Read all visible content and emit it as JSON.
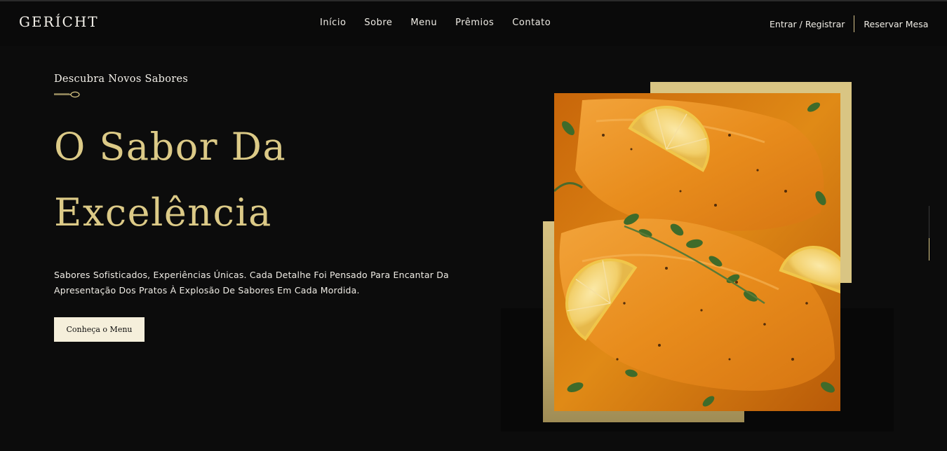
{
  "brand": {
    "logo": "GERÍCHT"
  },
  "nav": {
    "links": [
      "Início",
      "Sobre",
      "Menu",
      "Prêmios",
      "Contato"
    ],
    "login": "Entrar / Registrar",
    "reserve": "Reservar Mesa"
  },
  "hero": {
    "subtitle": "Descubra Novos Sabores",
    "title_line1": "O Sabor Da",
    "title_line2": "Excelência",
    "description": "Sabores Sofisticados, Experiências Únicas. Cada Detalhe Foi Pensado Para Encantar Da Apresentação Dos Pratos À Explosão De Sabores Em Cada Mordida.",
    "button": "Conheça o Menu"
  },
  "colors": {
    "background": "#0c0c0c",
    "accent_gold": "#dcca87",
    "button_bg": "#f5efdb",
    "text_light": "#f0ede6"
  },
  "icons": {
    "spoon": "spoon-icon"
  }
}
